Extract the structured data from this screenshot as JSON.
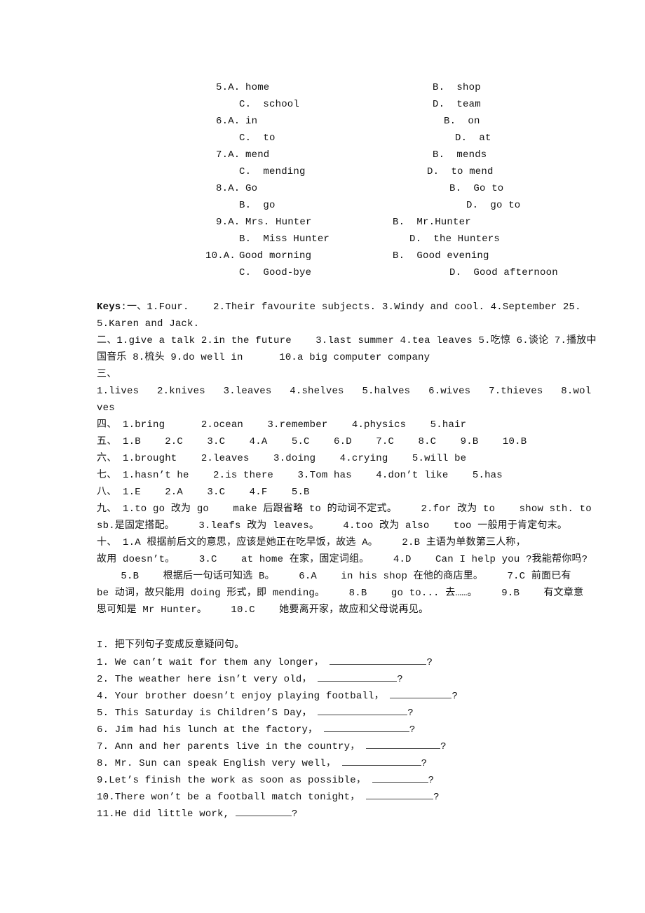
{
  "options": [
    {
      "q": "5.A.",
      "a": "home",
      "b": "B.  shop",
      "c": "C.  school",
      "d": "D.  team"
    },
    {
      "q": "6.A.",
      "a": "in",
      "b": "B.  on",
      "c": "C.  to",
      "d": "D.  at"
    },
    {
      "q": "7.A.",
      "a": "mend",
      "b": "B.  mends",
      "c": "C.  mending",
      "d": "D.  to mend"
    },
    {
      "q": "8.A.",
      "a": "Go",
      "b": "B.  Go to",
      "c": "B.  go",
      "d": "D.  go to"
    },
    {
      "q": "9.A.",
      "a": "Mrs. Hunter",
      "b": "B.  Mr.Hunter",
      "c": "B.  Miss Hunter",
      "d": "D.  the Hunters"
    },
    {
      "q": "10.A.",
      "a": "Good morning",
      "b": "B.  Good evening",
      "c": "C.  Good-bye",
      "d": "D.  Good afternoon"
    }
  ],
  "keys": {
    "label": "Keys",
    "lines": [
      ":一、1.Four.    2.Their favourite subjects. 3.Windy and cool. 4.September 25.",
      "5.Karen and Jack.",
      "二、1.give a talk 2.in the future    3.last summer 4.tea leaves 5.吃惊 6.谈论 7.播放中",
      "国音乐 8.梳头 9.do well in      10.a big computer company",
      "三、",
      "1.lives   2.knives   3.leaves   4.shelves   5.halves   6.wives   7.thieves   8.wol",
      "ves",
      "四、 1.bring      2.ocean    3.remember    4.physics    5.hair",
      "五、 1.B    2.C    3.C    4.A    5.C    6.D    7.C    8.C    9.B    10.B",
      "六、 1.brought    2.leaves    3.doing    4.crying    5.will be",
      "七、 1.hasn’t he    2.is there    3.Tom has    4.don’t like    5.has",
      "八、 1.E    2.A    3.C    4.F    5.B",
      "九、 1.to go 改为 go    make 后跟省略 to 的动词不定式。    2.for 改为 to    show sth. to",
      "sb.是固定搭配。    3.leafs 改为 leaves。    4.too 改为 also    too 一般用于肯定句末。",
      "十、 1.A 根据前后文的意思，应该是她正在吃早饭，故选 A。    2.B 主语为单数第三人称，",
      "故用 doesn’t。    3.C    at home 在家，固定词组。    4.D    Can I help you ?我能帮你吗?",
      "    5.B    根据后一句话可知选 B。    6.A    in his shop 在他的商店里。    7.C 前面已有",
      "be 动词，故只能用 doing 形式，即 mending。    8.B    go to... 去……。    9.B    有文章意",
      "思可知是 Mr Hunter。    10.C    她要离开家，故应和父母说再见。"
    ]
  },
  "exercise": {
    "title": "I. 把下列句子变成反意疑问句。",
    "items": [
      {
        "text": "1. We can’t wait for them any longer，",
        "end": "?"
      },
      {
        "text": "2. The weather here isn’t very old，",
        "end": "?"
      },
      {
        "text": "4. Your brother doesn’t enjoy playing football，",
        "end": "?"
      },
      {
        "text": "5. This Saturday is Children’S Day，",
        "end": "?"
      },
      {
        "text": "6. Jim had his lunch at the factory，",
        "end": "?"
      },
      {
        "text": "7. Ann and her parents live in the country，",
        "end": "?"
      },
      {
        "text": "8. Mr. Sun can speak English very well，",
        "end": "?"
      },
      {
        "text": "9.Let’s finish the work as soon as possible，",
        "end": "?"
      },
      {
        "text": "10.There won’t be a football match tonight，",
        "end": "?"
      },
      {
        "text": "11.He did little work,",
        "end": "?"
      }
    ]
  }
}
